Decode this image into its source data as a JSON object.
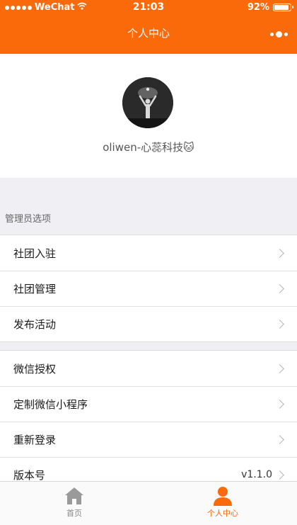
{
  "status_bar": {
    "carrier": "WeChat",
    "time": "21:03",
    "battery": "92%",
    "battery_level": 0.92
  },
  "nav": {
    "title": "个人中心"
  },
  "profile": {
    "username": "oliwen-心蕊科技🐱"
  },
  "admin_section": {
    "title": "管理员选项",
    "items": [
      {
        "label": "社团入驻"
      },
      {
        "label": "社团管理"
      },
      {
        "label": "发布活动"
      }
    ]
  },
  "settings": {
    "items": [
      {
        "label": "微信授权"
      },
      {
        "label": "定制微信小程序"
      },
      {
        "label": "重新登录"
      },
      {
        "label": "版本号",
        "value": "v1.1.0"
      }
    ]
  },
  "tabbar": {
    "tabs": [
      {
        "label": "首页",
        "icon": "home-icon"
      },
      {
        "label": "个人中心",
        "icon": "user-icon",
        "active": true
      }
    ]
  },
  "colors": {
    "accent": "#fb6a0a"
  }
}
